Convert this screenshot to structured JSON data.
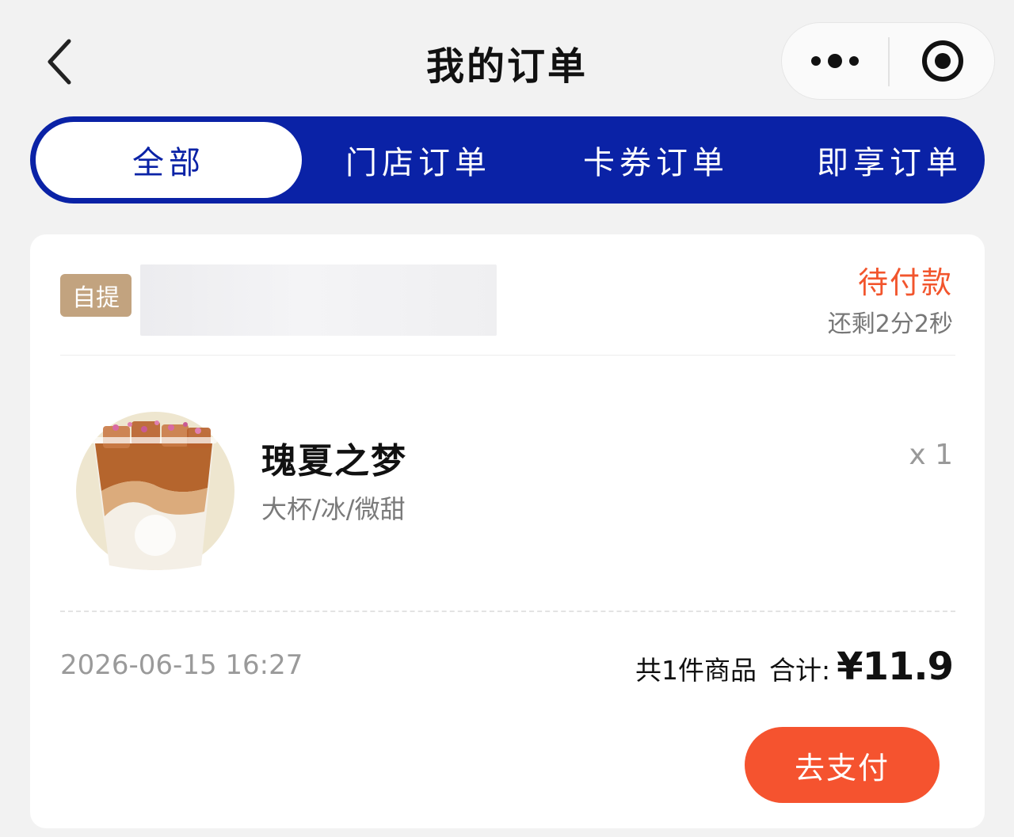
{
  "header": {
    "title": "我的订单",
    "back_icon": "chevron-left-icon",
    "more_icon": "more-dots-icon",
    "close_icon": "target-circle-icon"
  },
  "tabs": [
    {
      "label": "全部",
      "active": true
    },
    {
      "label": "门店订单",
      "active": false
    },
    {
      "label": "卡券订单",
      "active": false
    },
    {
      "label": "即享订单",
      "active": false
    }
  ],
  "order": {
    "pickup_badge": "自提",
    "status": "待付款",
    "countdown": "还剩2分2秒",
    "product": {
      "name": "瑰夏之梦",
      "spec": "大杯/冰/微甜",
      "quantity": "x 1"
    },
    "time": "2026-06-15 16:27",
    "item_count": "共1件商品",
    "total_label": "合计:",
    "total_value": "¥11.9",
    "pay_button": "去支付"
  },
  "colors": {
    "brand_blue": "#0a22a6",
    "status_orange": "#f2552d",
    "pay_button": "#f5532f",
    "badge": "#c2a37f"
  }
}
